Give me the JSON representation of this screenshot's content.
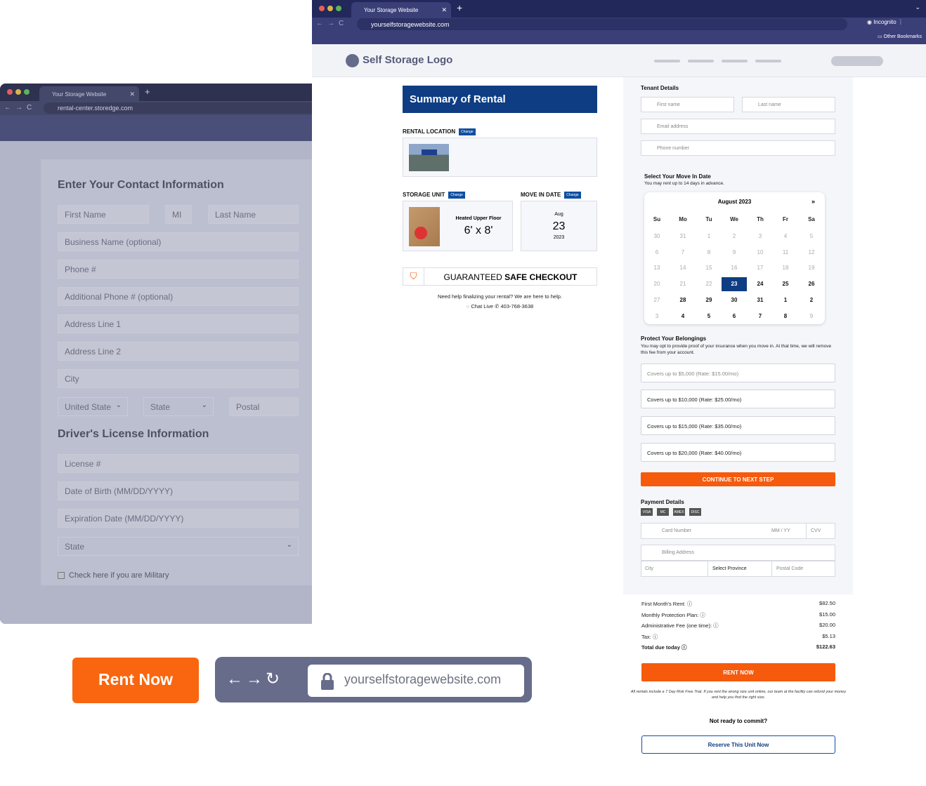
{
  "back_browser": {
    "tab_title": "Your Storage Website",
    "url": "rental-center.storedge.com",
    "heading": "Enter Your Contact Information",
    "fields": {
      "first_name": "First Name",
      "mi": "MI",
      "last_name": "Last Name",
      "business": "Business Name (optional)",
      "phone": "Phone #",
      "add_phone": "Additional Phone # (optional)",
      "addr1": "Address Line 1",
      "addr2": "Address Line 2",
      "city": "City",
      "country": "United State",
      "state": "State",
      "postal": "Postal"
    },
    "dl_heading": "Driver's License Information",
    "dl_fields": {
      "license": "License #",
      "dob": "Date of Birth (MM/DD/YYYY)",
      "exp": "Expiration Date (MM/DD/YYYY)",
      "state": "State"
    },
    "military": "Check here if you are Military"
  },
  "front_browser": {
    "tab_title": "Your Storage Website",
    "url": "yourselfstoragewebsite.com",
    "incognito": "Incognito",
    "bookmarks": "Other Bookmarks",
    "logo": "Self Storage Logo"
  },
  "summary": {
    "title": "Summary of Rental",
    "rental_location": "RENTAL LOCATION",
    "change": "Change",
    "storage_unit": "STORAGE UNIT",
    "move_in": "MOVE IN DATE",
    "unit_name": "Heated Upper Floor",
    "unit_size": "6' x 8'",
    "month": "Aug",
    "day": "23",
    "year": "2023",
    "guarantee_a": "GUARANTEED",
    "guarantee_b": "SAFE CHECKOUT",
    "help": "Need help finalizing your rental? We are here to help.",
    "chat": "Chat Live",
    "phone": "403-768-3638"
  },
  "tenant": {
    "title": "Tenant Details",
    "first": "First name",
    "last": "Last name",
    "email": "Email address",
    "phone": "Phone number"
  },
  "move_date": {
    "title": "Select Your Move In Date",
    "sub": "You may rent up to 14 days in advance.",
    "month": "August 2023",
    "next": "»",
    "days": [
      "Su",
      "Mo",
      "Tu",
      "We",
      "Th",
      "Fr",
      "Sa"
    ],
    "weeks": [
      [
        "30",
        "31",
        "1",
        "2",
        "3",
        "4",
        "5"
      ],
      [
        "6",
        "7",
        "8",
        "9",
        "10",
        "11",
        "12"
      ],
      [
        "13",
        "14",
        "15",
        "16",
        "17",
        "18",
        "19"
      ],
      [
        "20",
        "21",
        "22",
        "23",
        "24",
        "25",
        "26"
      ],
      [
        "27",
        "28",
        "29",
        "30",
        "31",
        "1",
        "2"
      ],
      [
        "3",
        "4",
        "5",
        "6",
        "7",
        "8",
        "9"
      ]
    ]
  },
  "protect": {
    "title": "Protect Your Belongings",
    "sub": "You may opt to provide proof of your insurance when you move in. At that time, we will remove this fee from your account.",
    "options": [
      "Covers up to $5,000 (Rate: $15.00/mo)",
      "Covers up to $10,000 (Rate: $25.00/mo)",
      "Covers up to $15,000 (Rate: $35.00/mo)",
      "Covers up to $20,000 (Rate: $40.00/mo)"
    ],
    "continue": "CONTINUE TO NEXT STEP"
  },
  "payment": {
    "title": "Payment Details",
    "card": "Card Number",
    "mmyy": "MM / YY",
    "cvv": "CVV",
    "billing": "Billing Address",
    "city": "City",
    "province": "Select Province",
    "postal": "Postal Code",
    "cards": [
      "VISA",
      "MC",
      "AMEX",
      "DISC"
    ]
  },
  "totals": [
    {
      "label": "First Month's Rent:",
      "value": "$82.50"
    },
    {
      "label": "Monthly Protection Plan:",
      "value": "$15.00"
    },
    {
      "label": "Administrative Fee (one time):",
      "value": "$20.00"
    },
    {
      "label": "Tax:",
      "value": "$5.13"
    },
    {
      "label": "Total due today",
      "value": "$122.63"
    }
  ],
  "rent_now": "RENT NOW",
  "fine_print": "All rentals include a 7 Day Risk Free Trial. If you rent the wrong size unit online, our team at the facility can refund your money and help you find the right size.",
  "not_ready": "Not ready to commit?",
  "reserve": "Reserve This Unit Now",
  "overlay": {
    "rent_now": "Rent Now",
    "url": "yourselfstoragewebsite.com"
  },
  "colors": {
    "brand_orange": "#f55a0d",
    "brand_navy": "#0e3d83",
    "chrome": "#22285a"
  }
}
